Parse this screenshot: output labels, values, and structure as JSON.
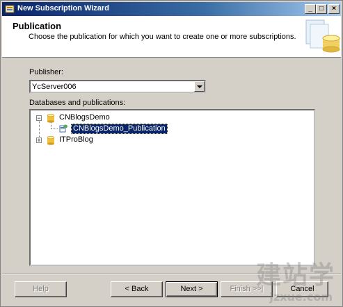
{
  "window": {
    "title": "New Subscription Wizard",
    "caption_buttons": {
      "minimize": "_",
      "maximize": "□",
      "close": "×"
    }
  },
  "header": {
    "title": "Publication",
    "subtitle": "Choose the publication for which you want to create one or more subscriptions."
  },
  "publisher": {
    "label": "Publisher:",
    "selected": "YcServer006"
  },
  "tree": {
    "label": "Databases and publications:",
    "nodes": [
      {
        "label": "CNBlogsDemo",
        "expanded": true,
        "icon": "database-icon",
        "children": [
          {
            "label": "CNBlogsDemo_Publication",
            "icon": "publication-icon",
            "selected": true
          }
        ]
      },
      {
        "label": "ITProBlog",
        "expanded": false,
        "icon": "database-icon"
      }
    ]
  },
  "buttons": {
    "help": "Help",
    "back": "< Back",
    "next": "Next >",
    "finish": "Finish >>|",
    "cancel": "Cancel"
  },
  "watermark": {
    "text": "建站学",
    "subtext": "jzxue.com"
  },
  "colors": {
    "titlebar_start": "#0a246a",
    "titlebar_end": "#a6caf0",
    "face": "#d4d0c8",
    "selection": "#0a246a"
  }
}
